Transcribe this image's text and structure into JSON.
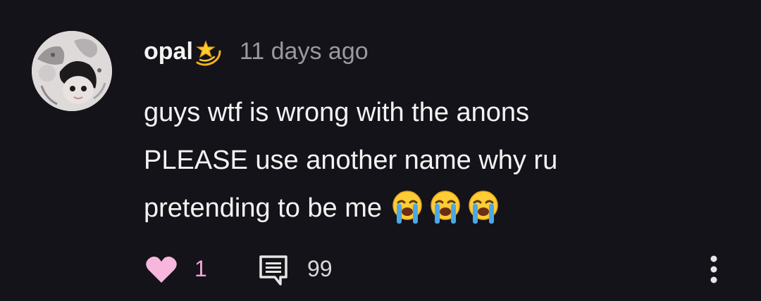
{
  "comment": {
    "author": "opal",
    "author_badge_icon": "dizzy-star-icon",
    "timestamp": "11 days ago",
    "body_lines": [
      "guys wtf is wrong with the anons",
      "PLEASE use another name why ru",
      "pretending to be me"
    ],
    "trailing_emojis": [
      "loudly-crying-face-icon",
      "loudly-crying-face-icon",
      "loudly-crying-face-icon"
    ],
    "likes": "1",
    "replies": "99"
  },
  "icons": {
    "like": "heart-icon",
    "reply": "comment-bubble-icon",
    "more": "more-vertical-icon"
  },
  "colors": {
    "background": "#141319",
    "text": "#f2f2f2",
    "muted": "#9a99a0",
    "like_pink": "#f3a7d6"
  }
}
